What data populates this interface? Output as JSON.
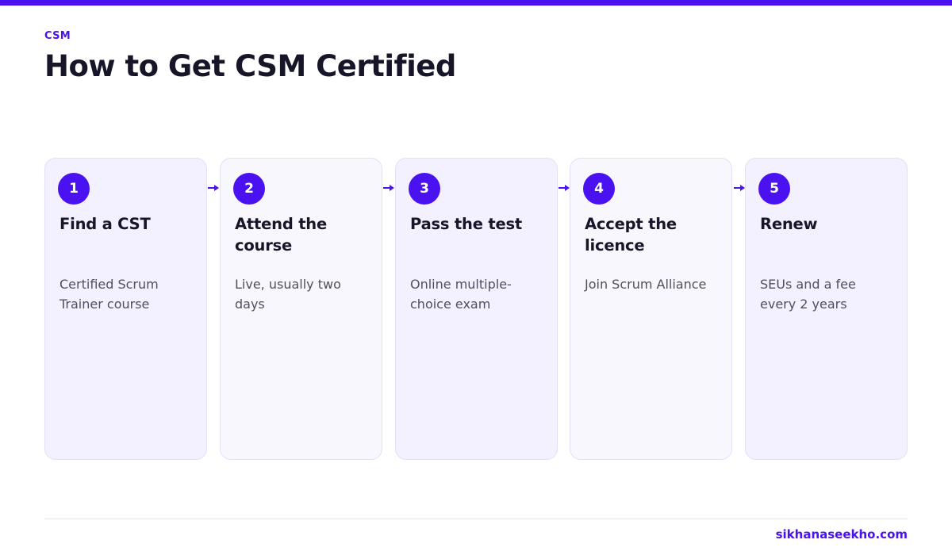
{
  "header": {
    "eyebrow": "CSM",
    "title": "How to Get CSM Certified"
  },
  "steps": [
    {
      "number": "1",
      "title": "Find a CST",
      "description": "Certified Scrum Trainer course"
    },
    {
      "number": "2",
      "title": "Attend the course",
      "description": "Live, usually two days"
    },
    {
      "number": "3",
      "title": "Pass the test",
      "description": "Online multiple-choice exam"
    },
    {
      "number": "4",
      "title": "Accept the licence",
      "description": "Join Scrum Alliance"
    },
    {
      "number": "5",
      "title": "Renew",
      "description": "SEUs and a fee every 2 years"
    }
  ],
  "connector_icon": "arrow-right-icon",
  "footer": {
    "site": "sikhanaseekho.com"
  },
  "colors": {
    "accent": "#4a12f0",
    "heading": "#161628",
    "card_tint": "#f3f0ff",
    "card_light": "#f8f7fd"
  }
}
